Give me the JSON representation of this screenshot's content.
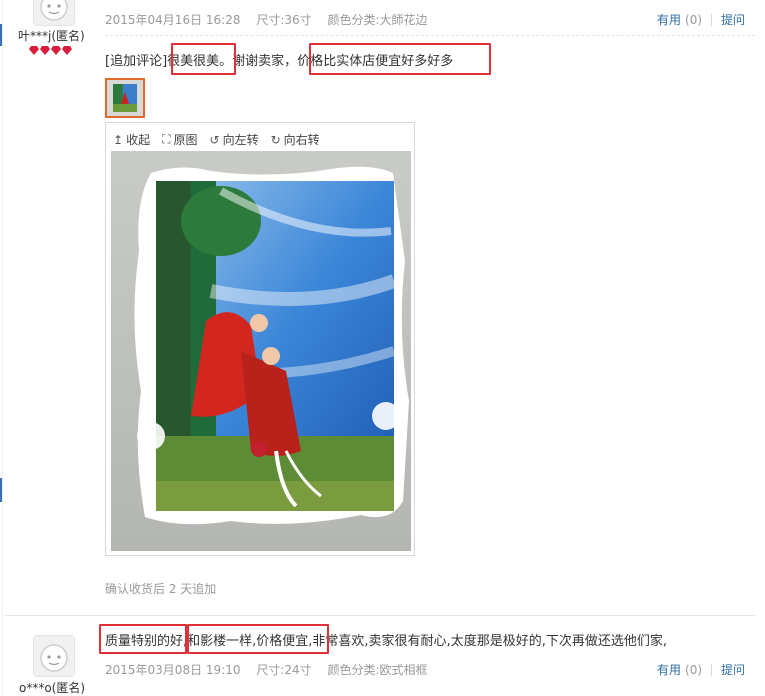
{
  "reviews": [
    {
      "user": "叶***j(匿名)",
      "badge_count": 4,
      "date": "2015年04月16日 16:28",
      "size": "尺寸:36寸",
      "color": "颜色分类:大師花边",
      "useful_label": "有用",
      "useful_count": "(0)",
      "ask_label": "提问",
      "append_prefix": "[追加评论]",
      "text_parts": [
        "很美很美",
        "。谢谢卖家，",
        "价格比实体店便宜好多好多"
      ],
      "viewer": {
        "collapse": "收起",
        "original": "原图",
        "rotate_left": "向左转",
        "rotate_right": "向右转"
      },
      "followup_note": "确认收货后 2 天追加"
    },
    {
      "user": "o***o(匿名)",
      "text_parts": [
        "质量特别的好",
        ",和影楼一样,",
        "价格便宜",
        ",非常喜欢,卖家很有耐心,太度那是极好的,下次再做还选他们家,"
      ],
      "date": "2015年03月08日 19:10",
      "size": "尺寸:24寸",
      "color": "颜色分类:欧式相框",
      "useful_label": "有用",
      "useful_count": "(0)",
      "ask_label": "提问"
    }
  ],
  "colors": {
    "highlight": "#e0303a",
    "link": "#2e6da4",
    "badge": "#d81e3c",
    "thumb_border": "#e06a2c"
  }
}
